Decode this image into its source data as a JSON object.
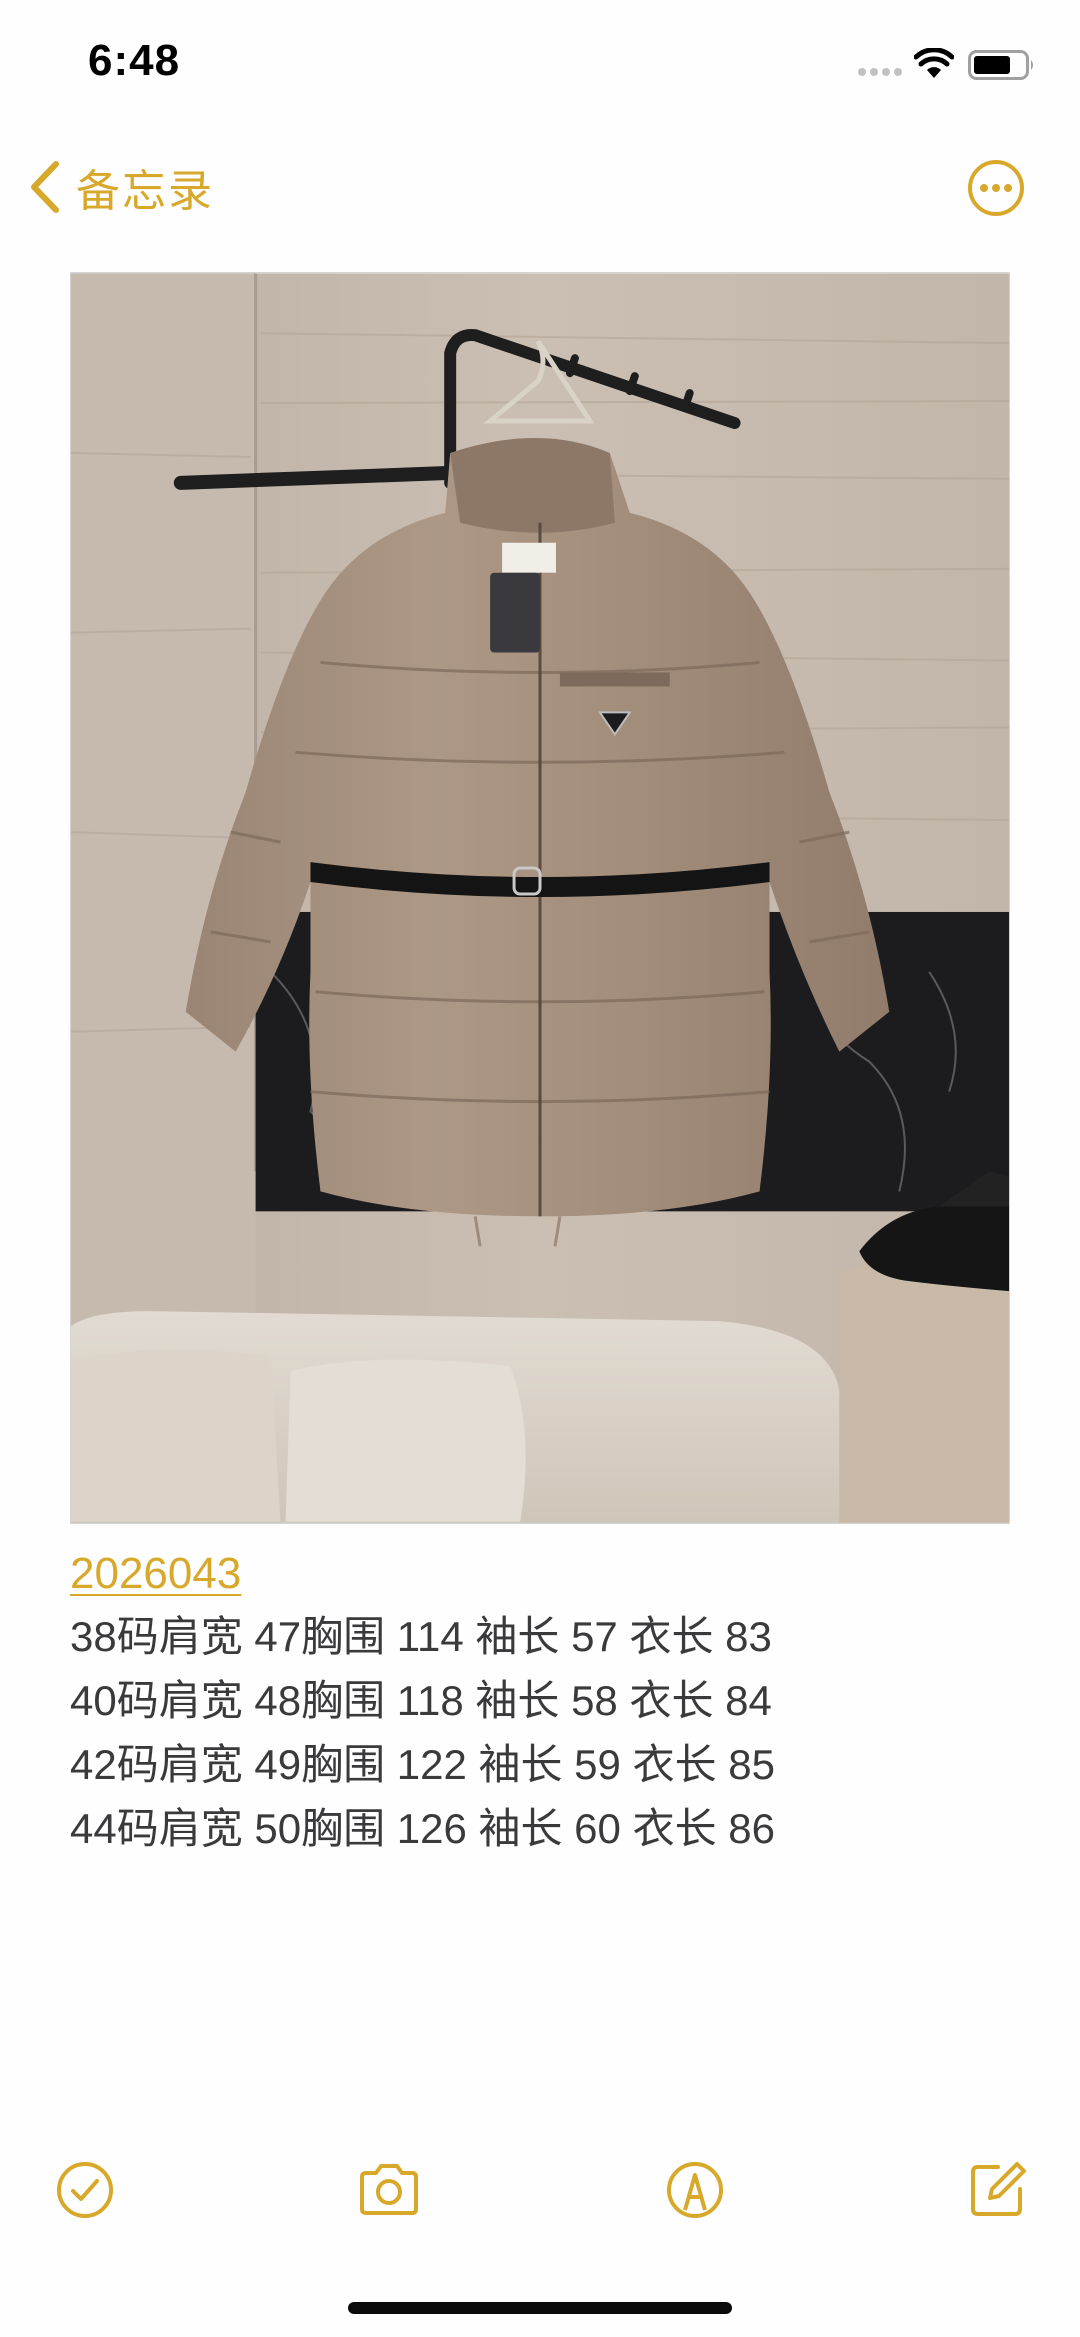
{
  "status_bar": {
    "time": "6:48",
    "icons": [
      "cellular-signal-icon",
      "wifi-icon",
      "battery-icon"
    ]
  },
  "nav": {
    "back_label": "备忘录",
    "back_icon": "chevron-left-icon",
    "more_icon": "ellipsis-circle-icon"
  },
  "theme": {
    "accent": "#d7a82a",
    "text": "#3a3a3c"
  },
  "attachment": {
    "subject": "Khaki belted puffer down jacket hanging on a wall rack"
  },
  "note": {
    "link": "2026043",
    "lines": [
      "38码肩宽 47胸围 114 袖长 57 衣长 83",
      "40码肩宽 48胸围 118 袖长 58 衣长 84",
      "42码肩宽 49胸围 122 袖长 59 衣长 85",
      "44码肩宽 50胸围 126 袖长 60 衣长 86"
    ]
  },
  "toolbar": {
    "icons": [
      "checklist-icon",
      "camera-icon",
      "markup-pen-icon",
      "compose-icon"
    ]
  }
}
